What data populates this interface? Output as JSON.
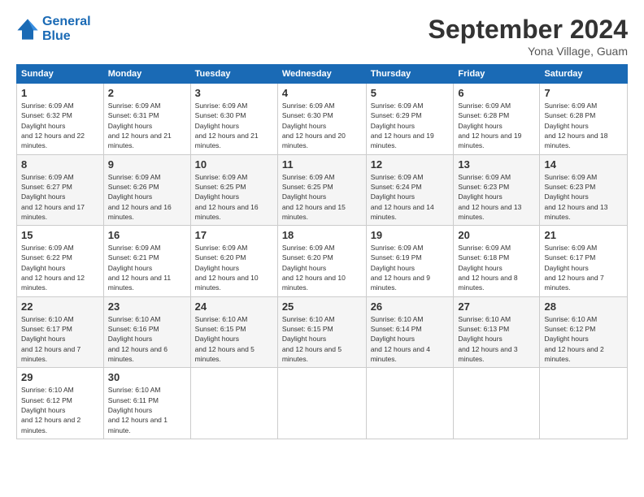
{
  "header": {
    "logo_line1": "General",
    "logo_line2": "Blue",
    "month_title": "September 2024",
    "location": "Yona Village, Guam"
  },
  "days_of_week": [
    "Sunday",
    "Monday",
    "Tuesday",
    "Wednesday",
    "Thursday",
    "Friday",
    "Saturday"
  ],
  "weeks": [
    [
      {
        "num": "1",
        "rise": "6:09 AM",
        "set": "6:32 PM",
        "daylight": "12 hours and 22 minutes."
      },
      {
        "num": "2",
        "rise": "6:09 AM",
        "set": "6:31 PM",
        "daylight": "12 hours and 21 minutes."
      },
      {
        "num": "3",
        "rise": "6:09 AM",
        "set": "6:30 PM",
        "daylight": "12 hours and 21 minutes."
      },
      {
        "num": "4",
        "rise": "6:09 AM",
        "set": "6:30 PM",
        "daylight": "12 hours and 20 minutes."
      },
      {
        "num": "5",
        "rise": "6:09 AM",
        "set": "6:29 PM",
        "daylight": "12 hours and 19 minutes."
      },
      {
        "num": "6",
        "rise": "6:09 AM",
        "set": "6:28 PM",
        "daylight": "12 hours and 19 minutes."
      },
      {
        "num": "7",
        "rise": "6:09 AM",
        "set": "6:28 PM",
        "daylight": "12 hours and 18 minutes."
      }
    ],
    [
      {
        "num": "8",
        "rise": "6:09 AM",
        "set": "6:27 PM",
        "daylight": "12 hours and 17 minutes."
      },
      {
        "num": "9",
        "rise": "6:09 AM",
        "set": "6:26 PM",
        "daylight": "12 hours and 16 minutes."
      },
      {
        "num": "10",
        "rise": "6:09 AM",
        "set": "6:25 PM",
        "daylight": "12 hours and 16 minutes."
      },
      {
        "num": "11",
        "rise": "6:09 AM",
        "set": "6:25 PM",
        "daylight": "12 hours and 15 minutes."
      },
      {
        "num": "12",
        "rise": "6:09 AM",
        "set": "6:24 PM",
        "daylight": "12 hours and 14 minutes."
      },
      {
        "num": "13",
        "rise": "6:09 AM",
        "set": "6:23 PM",
        "daylight": "12 hours and 13 minutes."
      },
      {
        "num": "14",
        "rise": "6:09 AM",
        "set": "6:23 PM",
        "daylight": "12 hours and 13 minutes."
      }
    ],
    [
      {
        "num": "15",
        "rise": "6:09 AM",
        "set": "6:22 PM",
        "daylight": "12 hours and 12 minutes."
      },
      {
        "num": "16",
        "rise": "6:09 AM",
        "set": "6:21 PM",
        "daylight": "12 hours and 11 minutes."
      },
      {
        "num": "17",
        "rise": "6:09 AM",
        "set": "6:20 PM",
        "daylight": "12 hours and 10 minutes."
      },
      {
        "num": "18",
        "rise": "6:09 AM",
        "set": "6:20 PM",
        "daylight": "12 hours and 10 minutes."
      },
      {
        "num": "19",
        "rise": "6:09 AM",
        "set": "6:19 PM",
        "daylight": "12 hours and 9 minutes."
      },
      {
        "num": "20",
        "rise": "6:09 AM",
        "set": "6:18 PM",
        "daylight": "12 hours and 8 minutes."
      },
      {
        "num": "21",
        "rise": "6:09 AM",
        "set": "6:17 PM",
        "daylight": "12 hours and 7 minutes."
      }
    ],
    [
      {
        "num": "22",
        "rise": "6:10 AM",
        "set": "6:17 PM",
        "daylight": "12 hours and 7 minutes."
      },
      {
        "num": "23",
        "rise": "6:10 AM",
        "set": "6:16 PM",
        "daylight": "12 hours and 6 minutes."
      },
      {
        "num": "24",
        "rise": "6:10 AM",
        "set": "6:15 PM",
        "daylight": "12 hours and 5 minutes."
      },
      {
        "num": "25",
        "rise": "6:10 AM",
        "set": "6:15 PM",
        "daylight": "12 hours and 5 minutes."
      },
      {
        "num": "26",
        "rise": "6:10 AM",
        "set": "6:14 PM",
        "daylight": "12 hours and 4 minutes."
      },
      {
        "num": "27",
        "rise": "6:10 AM",
        "set": "6:13 PM",
        "daylight": "12 hours and 3 minutes."
      },
      {
        "num": "28",
        "rise": "6:10 AM",
        "set": "6:12 PM",
        "daylight": "12 hours and 2 minutes."
      }
    ],
    [
      {
        "num": "29",
        "rise": "6:10 AM",
        "set": "6:12 PM",
        "daylight": "12 hours and 2 minutes."
      },
      {
        "num": "30",
        "rise": "6:10 AM",
        "set": "6:11 PM",
        "daylight": "12 hours and 1 minute."
      },
      null,
      null,
      null,
      null,
      null
    ]
  ]
}
